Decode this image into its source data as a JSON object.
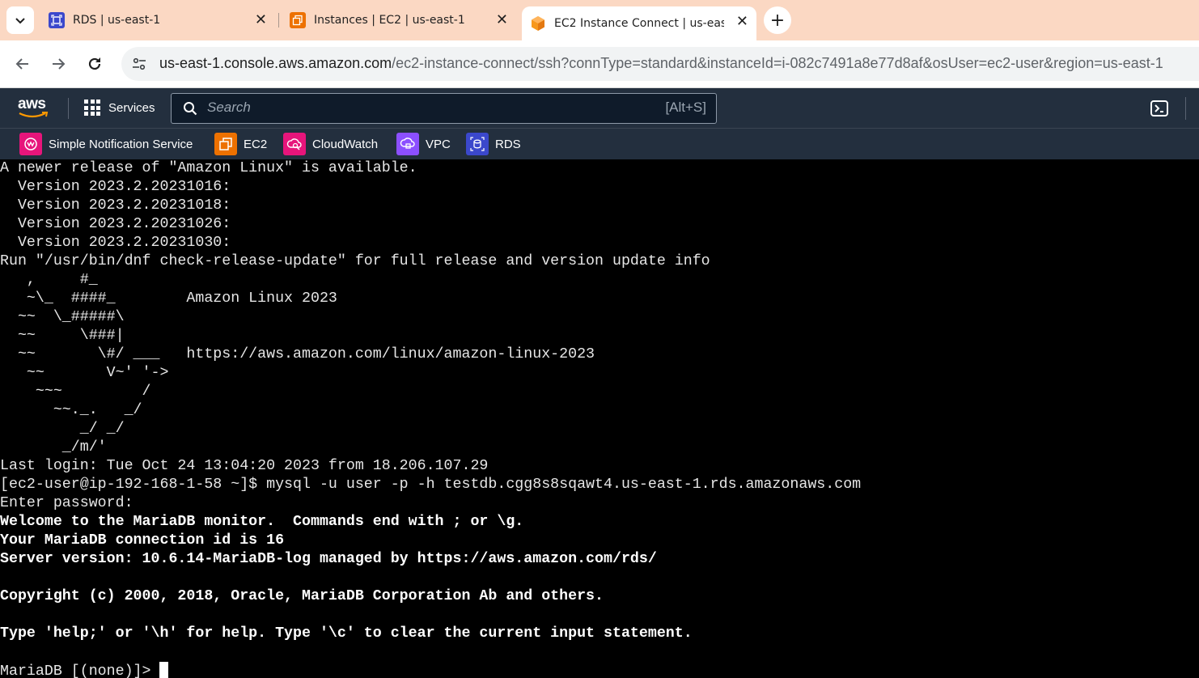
{
  "browser": {
    "tabs": [
      {
        "title": "RDS | us-east-1",
        "active": false
      },
      {
        "title": "Instances | EC2 | us-east-1",
        "active": false
      },
      {
        "title": "EC2 Instance Connect | us-eas",
        "active": true
      }
    ],
    "close_glyph": "✕",
    "new_tab_glyph": "+",
    "url_host": "us-east-1.console.aws.amazon.com",
    "url_path": "/ec2-instance-connect/ssh?connType=standard&instanceId=i-082c7491a8e77d8af&osUser=ec2-user&region=us-east-1"
  },
  "aws": {
    "logo_text": "aws",
    "services_label": "Services",
    "search_placeholder": "Search",
    "search_shortcut": "[Alt+S]",
    "favorites": [
      {
        "label": "Simple Notification Service",
        "color": "#e7157b"
      },
      {
        "label": "EC2",
        "color": "#ed7100"
      },
      {
        "label": "CloudWatch",
        "color": "#e7157b"
      },
      {
        "label": "VPC",
        "color": "#8c4fff"
      },
      {
        "label": "RDS",
        "color": "#3b48cc"
      }
    ]
  },
  "terminal": {
    "lines": [
      {
        "text": "A newer release of \"Amazon Linux\" is available.",
        "bold": false
      },
      {
        "text": "  Version 2023.2.20231016:",
        "bold": false
      },
      {
        "text": "  Version 2023.2.20231018:",
        "bold": false
      },
      {
        "text": "  Version 2023.2.20231026:",
        "bold": false
      },
      {
        "text": "  Version 2023.2.20231030:",
        "bold": false
      },
      {
        "text": "Run \"/usr/bin/dnf check-release-update\" for full release and version update info",
        "bold": false
      },
      {
        "text": "   ,     #_",
        "bold": false
      },
      {
        "text": "   ~\\_  ####_        Amazon Linux 2023",
        "bold": false
      },
      {
        "text": "  ~~  \\_#####\\",
        "bold": false
      },
      {
        "text": "  ~~     \\###|",
        "bold": false
      },
      {
        "text": "  ~~       \\#/ ___   https://aws.amazon.com/linux/amazon-linux-2023",
        "bold": false
      },
      {
        "text": "   ~~       V~' '->",
        "bold": false
      },
      {
        "text": "    ~~~         /",
        "bold": false
      },
      {
        "text": "      ~~._.   _/",
        "bold": false
      },
      {
        "text": "         _/ _/",
        "bold": false
      },
      {
        "text": "       _/m/'",
        "bold": false
      },
      {
        "text": "Last login: Tue Oct 24 13:04:20 2023 from 18.206.107.29",
        "bold": false
      },
      {
        "text": "[ec2-user@ip-192-168-1-58 ~]$ mysql -u user -p -h testdb.cgg8s8sqawt4.us-east-1.rds.amazonaws.com",
        "bold": false
      },
      {
        "text": "Enter password:",
        "bold": false
      },
      {
        "text": "Welcome to the MariaDB monitor.  Commands end with ; or \\g.",
        "bold": true
      },
      {
        "text": "Your MariaDB connection id is 16",
        "bold": true
      },
      {
        "text": "Server version: 10.6.14-MariaDB-log managed by https://aws.amazon.com/rds/",
        "bold": true
      },
      {
        "text": "",
        "bold": false
      },
      {
        "text": "Copyright (c) 2000, 2018, Oracle, MariaDB Corporation Ab and others.",
        "bold": true
      },
      {
        "text": "",
        "bold": false
      },
      {
        "text": "Type 'help;' or '\\h' for help. Type '\\c' to clear the current input statement.",
        "bold": true
      },
      {
        "text": "",
        "bold": false
      }
    ],
    "prompt": "MariaDB [(none)]> "
  }
}
